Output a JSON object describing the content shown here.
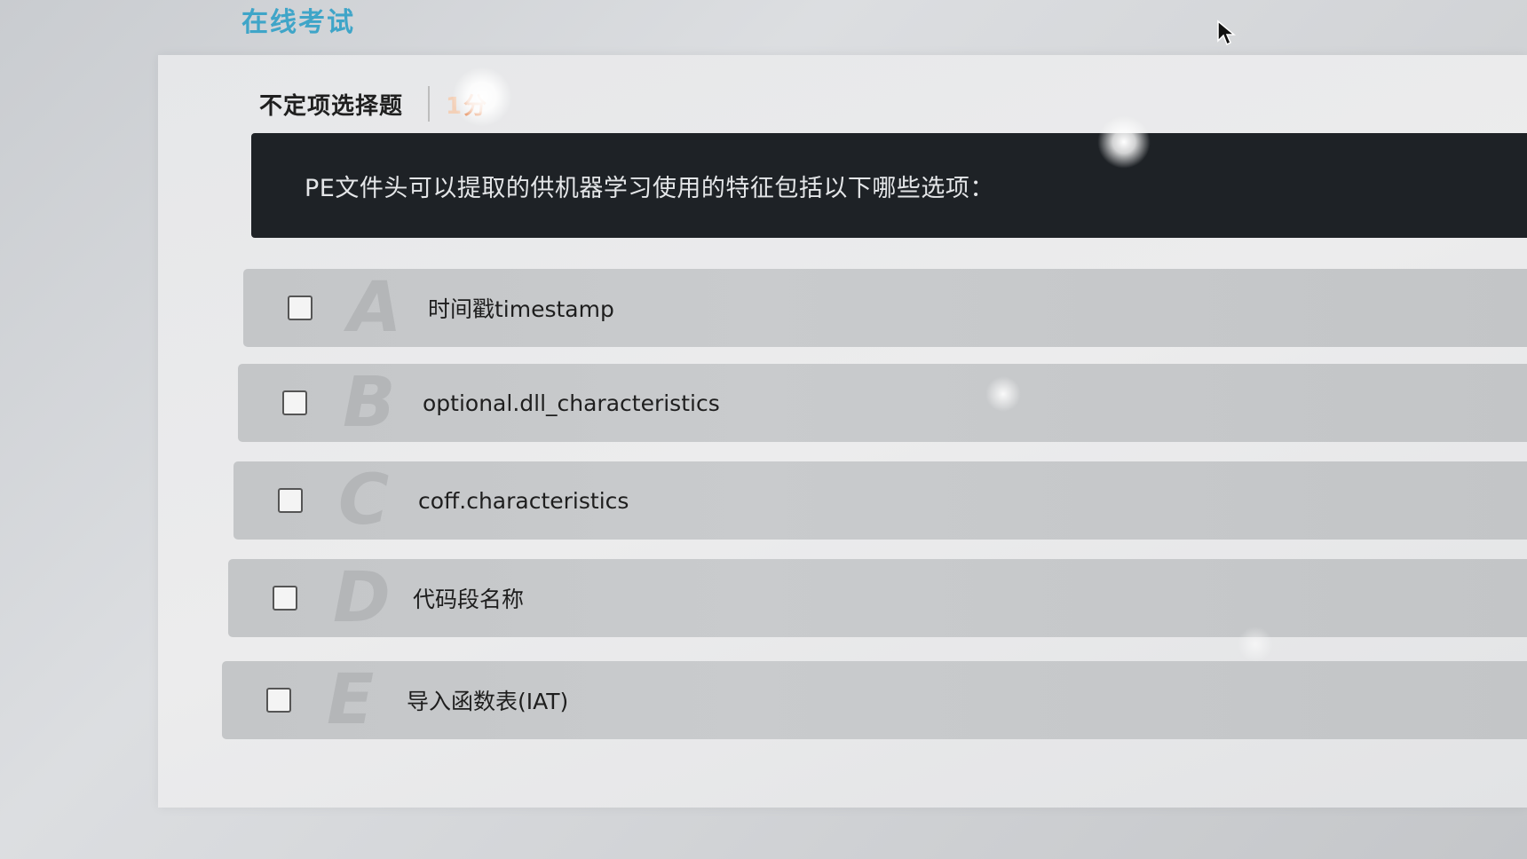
{
  "header": {
    "site_title": "在线考试"
  },
  "question": {
    "type_label": "不定项选择题",
    "score_number": "1",
    "score_unit": "分",
    "text": "PE文件头可以提取的供机器学习使用的特征包括以下哪些选项："
  },
  "options": [
    {
      "letter": "A",
      "label": "时间戳timestamp",
      "checked": false
    },
    {
      "letter": "B",
      "label": "optional.dll_characteristics",
      "checked": false
    },
    {
      "letter": "C",
      "label": "coff.characteristics",
      "checked": false
    },
    {
      "letter": "D",
      "label": "代码段名称",
      "checked": false
    },
    {
      "letter": "E",
      "label": "导入函数表(IAT)",
      "checked": false
    }
  ],
  "colors": {
    "title": "#3fa5c8",
    "score": "#e2773a",
    "question_bg": "#1e2226"
  },
  "icons": {
    "cursor": "mouse-pointer-icon"
  }
}
